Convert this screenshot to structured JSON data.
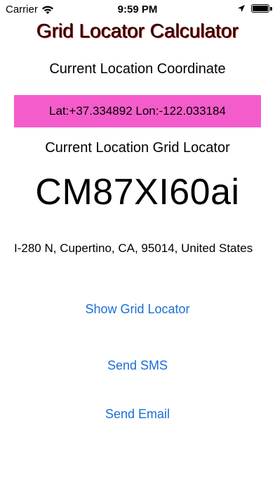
{
  "status_bar": {
    "carrier": "Carrier",
    "time": "9:59 PM",
    "icons": [
      "wifi-icon",
      "location-arrow-icon",
      "battery-icon"
    ]
  },
  "title": "Grid Locator Calculator",
  "coordinate_section": {
    "label": "Current Location Coordinate",
    "value": "Lat:+37.334892 Lon:-122.033184",
    "box_color": "#f55ccb"
  },
  "grid_section": {
    "label": "Current Location Grid Locator",
    "value": "CM87XI60ai"
  },
  "address": "I-280 N, Cupertino, CA, 95014, United States",
  "actions": {
    "show_grid_locator": "Show Grid Locator",
    "send_sms": "Send SMS",
    "send_email": "Send Email"
  },
  "colors": {
    "link": "#1a6ed8",
    "title_shadow": "#d01010"
  }
}
